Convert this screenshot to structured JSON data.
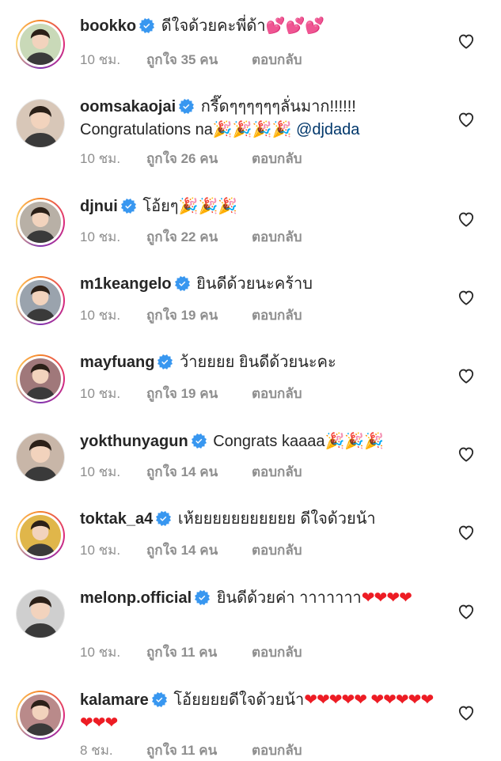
{
  "comments": [
    {
      "username": "bookko",
      "text": "ดีใจด้วยคะพี่ด้า",
      "emoji": "💕💕💕",
      "emoji_kind": "pink",
      "time": "10 ชม.",
      "likes": "ถูกใจ 35 คน",
      "reply": "ตอบกลับ",
      "avatar_color": "#c9d9b8",
      "story_ring": true
    },
    {
      "username": "oomsakaojai",
      "text": "กรี๊ดๆๆๆๆๆๆลั่นมาก!!!!!! Congratulations na",
      "emoji": "🎉🎉🎉🎉",
      "emoji_kind": "popper",
      "mention": "@djdada",
      "time": "10 ชม.",
      "likes": "ถูกใจ 26 คน",
      "reply": "ตอบกลับ",
      "avatar_color": "#d8c7b8",
      "story_ring": false
    },
    {
      "username": "djnui",
      "text": "โอ้ยๆ",
      "emoji": "🎉🎉🎉",
      "emoji_kind": "popper",
      "time": "10 ชม.",
      "likes": "ถูกใจ 22 คน",
      "reply": "ตอบกลับ",
      "avatar_color": "#b8b0a6",
      "story_ring": true
    },
    {
      "username": "m1keangelo",
      "text": "ยินดีด้วยนะคร้าบ",
      "time": "10 ชม.",
      "likes": "ถูกใจ 19 คน",
      "reply": "ตอบกลับ",
      "avatar_color": "#9aa3ad",
      "story_ring": true
    },
    {
      "username": "mayfuang",
      "text": "ว้ายยยย ยินดีด้วยนะคะ",
      "time": "10 ชม.",
      "likes": "ถูกใจ 19 คน",
      "reply": "ตอบกลับ",
      "avatar_color": "#a0787a",
      "story_ring": true
    },
    {
      "username": "yokthunyagun",
      "text": "Congrats kaaaa",
      "emoji": "🎉🎉🎉",
      "emoji_kind": "popper",
      "time": "10 ชม.",
      "likes": "ถูกใจ 14 คน",
      "reply": "ตอบกลับ",
      "avatar_color": "#c8b6a8",
      "story_ring": false
    },
    {
      "username": "toktak_a4",
      "text": "เห้ยยยยยยยยยยย ดีใจด้วยน้า",
      "time": "10 ชม.",
      "likes": "ถูกใจ 14 คน",
      "reply": "ตอบกลับ",
      "avatar_color": "#e0b64a",
      "story_ring": true
    },
    {
      "username": "melonp.official",
      "text": "ยินดีด้วยค่า าาาาาาา",
      "emoji": "❤❤❤❤",
      "emoji_kind": "hearts",
      "time": "10 ชม.",
      "likes": "ถูกใจ 11 คน",
      "reply": "ตอบกลับ",
      "avatar_color": "#cfcfcf",
      "story_ring": false
    },
    {
      "username": "kalamare",
      "text": "โอ้ยยยยดีใจด้วยน้า",
      "emoji": "❤❤❤❤❤ ❤❤❤❤❤❤❤❤",
      "emoji_kind": "hearts",
      "time": "8 ชม.",
      "likes": "ถูกใจ 11 คน",
      "reply": "ตอบกลับ",
      "avatar_color": "#b98a8a",
      "story_ring": true
    }
  ],
  "colors": {
    "username": "#262626",
    "meta": "#8e8e8e",
    "verified": "#3897f0",
    "mention": "#00376b",
    "heart_emoji": "#ed1c24"
  },
  "icons": {
    "verified": "verified-badge-icon",
    "like": "heart-outline-icon"
  }
}
